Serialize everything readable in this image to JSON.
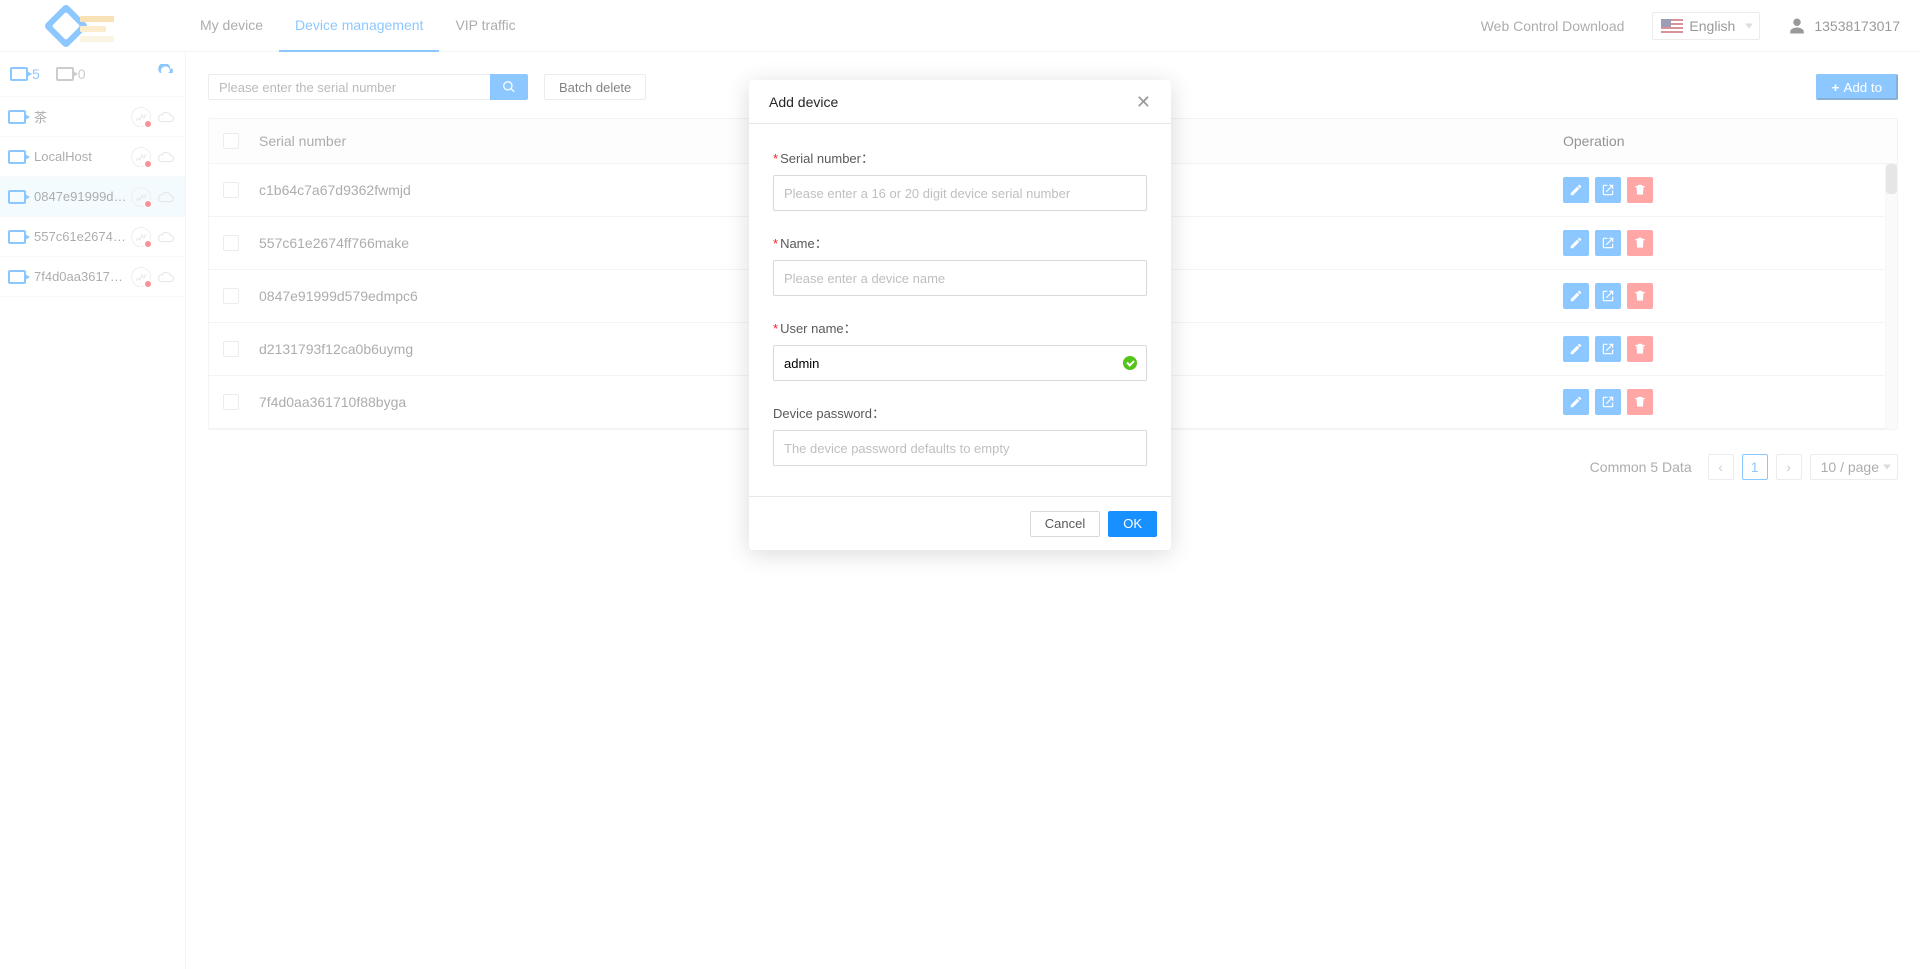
{
  "header": {
    "nav": {
      "my_device": "My device",
      "device_management": "Device management",
      "vip_traffic": "VIP traffic"
    },
    "download_link": "Web Control Download",
    "language_label": "English",
    "username": "13538173017"
  },
  "sidebar": {
    "camera_count": "5",
    "other_count": "0",
    "devices": [
      {
        "name": "茶"
      },
      {
        "name": "LocalHost"
      },
      {
        "name": "0847e91999d5..."
      },
      {
        "name": "557c61e2674ff..."
      },
      {
        "name": "7f4d0aa361710..."
      }
    ]
  },
  "toolbar": {
    "search_placeholder": "Please enter the serial number",
    "batch_delete": "Batch delete",
    "add_to": "Add to"
  },
  "table": {
    "col_serial": "Serial number",
    "col_operation": "Operation",
    "rows": [
      {
        "serial": "c1b64c7a67d9362fwmjd"
      },
      {
        "serial": "557c61e2674ff766make"
      },
      {
        "serial": "0847e91999d579edmpc6"
      },
      {
        "serial": "d2131793f12ca0b6uymg"
      },
      {
        "serial": "7f4d0aa361710f88byga"
      }
    ]
  },
  "pagination": {
    "total_label": "Common 5 Data",
    "current_page": "1",
    "page_size_label": "10 / page"
  },
  "modal": {
    "title": "Add device",
    "serial_label": "Serial number：",
    "serial_placeholder": "Please enter a 16 or 20 digit device serial number",
    "name_label": "Name：",
    "name_placeholder": "Please enter a device name",
    "username_label": "User name：",
    "username_value": "admin",
    "password_label": "Device password：",
    "password_placeholder": "The device password defaults to empty",
    "cancel": "Cancel",
    "ok": "OK"
  }
}
